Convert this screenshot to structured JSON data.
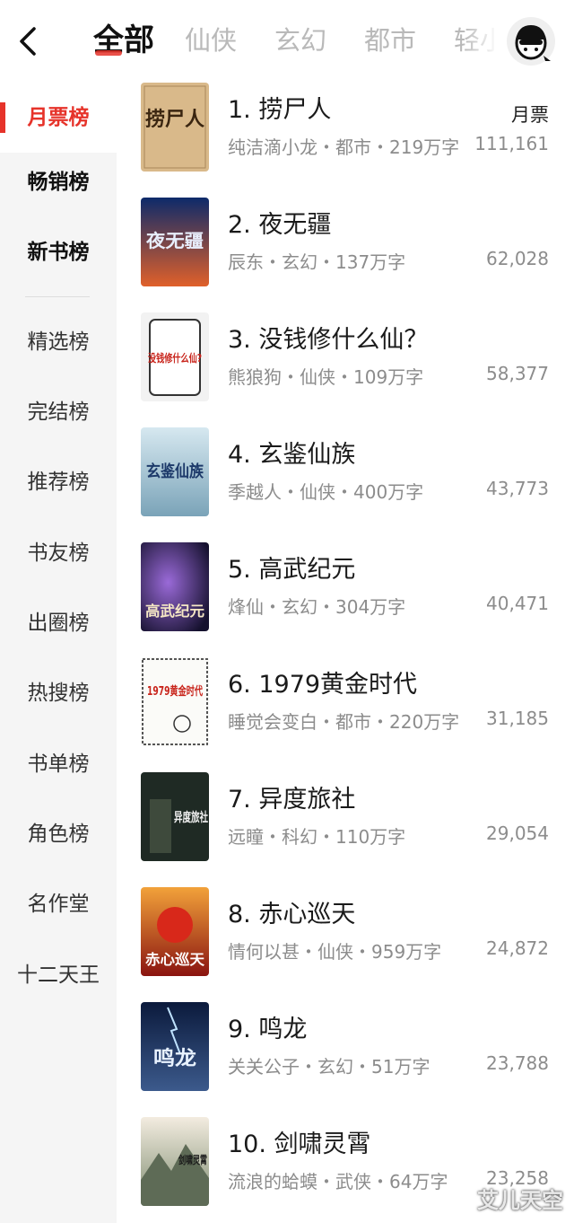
{
  "header": {
    "tabs": [
      "全部",
      "仙侠",
      "玄幻",
      "都市",
      "轻小说"
    ],
    "active_tab": 0
  },
  "sidebar": {
    "items": [
      "月票榜",
      "畅销榜",
      "新书榜",
      "精选榜",
      "完结榜",
      "推荐榜",
      "书友榜",
      "出圈榜",
      "热搜榜",
      "书单榜",
      "角色榜",
      "名作堂",
      "十二天王"
    ],
    "active_index": 0
  },
  "list": {
    "vote_label": "月票",
    "books": [
      {
        "title": "1. 捞尸人",
        "meta": "纯洁滴小龙・都市・219万字",
        "votes": "111,161",
        "cover_text": "捞尸人"
      },
      {
        "title": "2. 夜无疆",
        "meta": "辰东・玄幻・137万字",
        "votes": "62,028",
        "cover_text": "夜无疆"
      },
      {
        "title": "3. 没钱修什么仙？",
        "meta": "熊狼狗・仙侠・109万字",
        "votes": "58,377",
        "cover_text": "没钱修什么仙?"
      },
      {
        "title": "4. 玄鉴仙族",
        "meta": "季越人・仙侠・400万字",
        "votes": "43,773",
        "cover_text": "玄鉴仙族"
      },
      {
        "title": "5. 高武纪元",
        "meta": "烽仙・玄幻・304万字",
        "votes": "40,471",
        "cover_text": "高武纪元"
      },
      {
        "title": "6. 1979黄金时代",
        "meta": "睡觉会变白・都市・220万字",
        "votes": "31,185",
        "cover_text": "1979黄金时代"
      },
      {
        "title": "7. 异度旅社",
        "meta": "远瞳・科幻・110万字",
        "votes": "29,054",
        "cover_text": "异度旅社"
      },
      {
        "title": "8. 赤心巡天",
        "meta": "情何以甚・仙侠・959万字",
        "votes": "24,872",
        "cover_text": "赤心巡天"
      },
      {
        "title": "9. 鸣龙",
        "meta": "关关公子・玄幻・51万字",
        "votes": "23,788",
        "cover_text": "鸣龙"
      },
      {
        "title": "10. 剑啸灵霄",
        "meta": "流浪的蛤蟆・武侠・64万字",
        "votes": "23,258",
        "cover_text": "剑啸灵霄"
      }
    ]
  },
  "watermark": "艾儿天空",
  "colors": {
    "accent": "#e6332a",
    "muted": "#8c8c8c",
    "sidebar_bg": "#f5f5f5"
  }
}
